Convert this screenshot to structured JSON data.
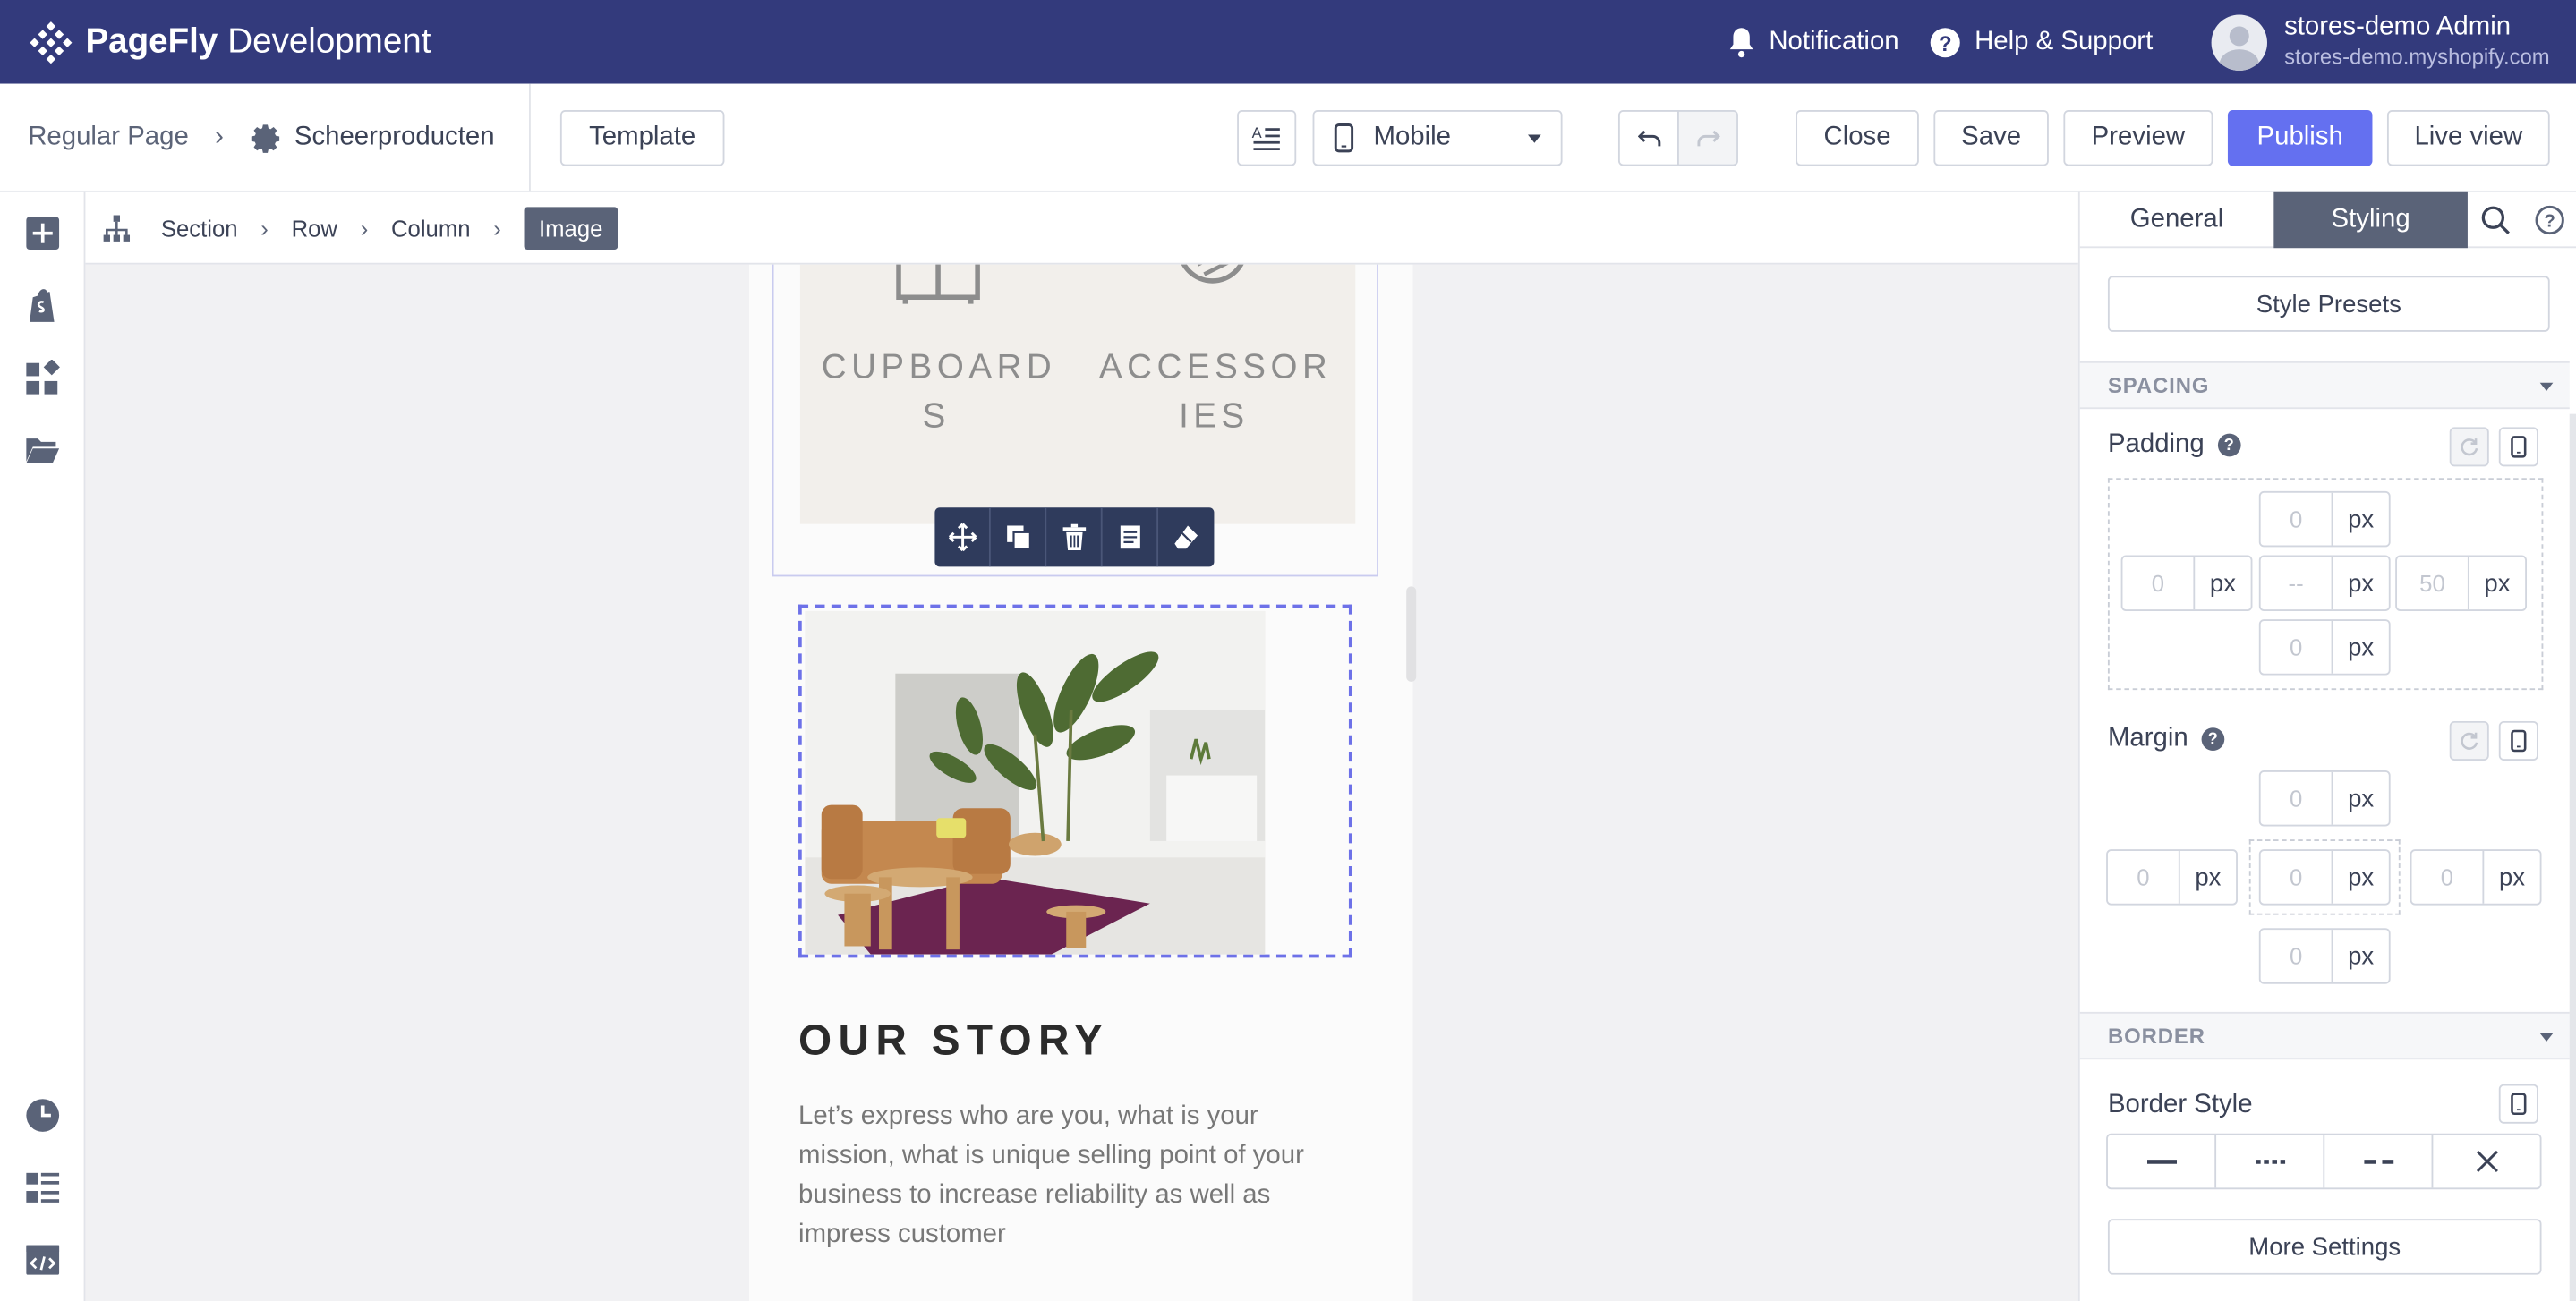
{
  "app": {
    "brand_bold": "PageFly",
    "brand_rest": "Development",
    "notification_label": "Notification",
    "help_label": "Help & Support",
    "user_name": "stores-demo Admin",
    "user_store": "stores-demo.myshopify.com"
  },
  "toolbar": {
    "page_type": "Regular Page",
    "page_name": "Scheerproducten",
    "template_label": "Template",
    "device_label": "Mobile",
    "close_label": "Close",
    "save_label": "Save",
    "preview_label": "Preview",
    "publish_label": "Publish",
    "live_view_label": "Live view"
  },
  "path": [
    "Section",
    "Row",
    "Column",
    "Image"
  ],
  "canvas": {
    "categories": [
      "CUPBOARDS",
      "ACCESSORIES"
    ],
    "category_lines": [
      [
        "CUPBOARD",
        "S"
      ],
      [
        "ACCESSOR",
        "IES"
      ]
    ],
    "story_title": "OUR STORY",
    "story_body": "Let’s express who are you, what is your mission, what is unique selling point of your business to increase reliability as well as impress customer"
  },
  "panel": {
    "tabs": [
      "General",
      "Styling"
    ],
    "style_presets_label": "Style Presets",
    "spacing_header": "SPACING",
    "padding_label": "Padding",
    "padding": {
      "top": "0",
      "left": "0",
      "center": "--",
      "right": "50",
      "bottom": "0",
      "unit": "px"
    },
    "margin_label": "Margin",
    "margin": {
      "top": "0",
      "left": "0",
      "center": "0",
      "right": "0",
      "bottom": "0",
      "unit": "px"
    },
    "border_header": "BORDER",
    "border_style_label": "Border Style",
    "more_settings_label": "More Settings"
  },
  "colors": {
    "topbar": "#333a7c",
    "accent": "#6470f0",
    "active_tab": "#5a6378"
  }
}
